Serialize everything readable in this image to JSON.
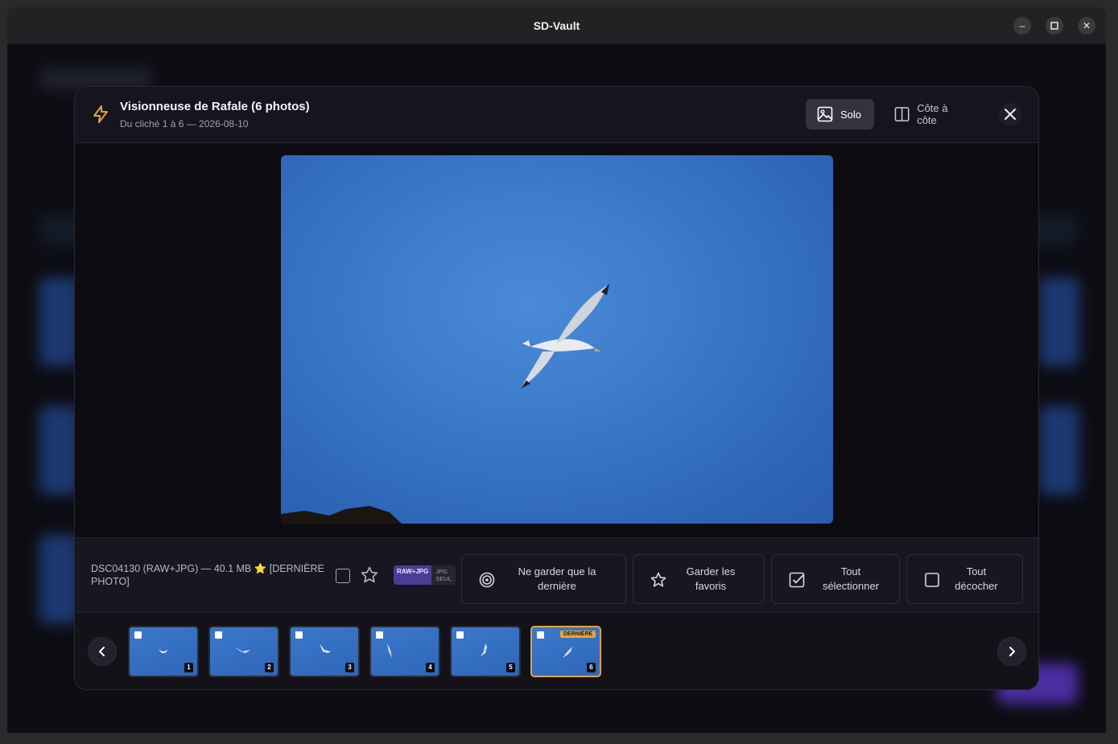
{
  "window": {
    "title": "SD-Vault"
  },
  "window_controls": {
    "minimize": "–",
    "maximize": "☐",
    "close": "✕"
  },
  "modal": {
    "title": "Visionneuse de Rafale (6 photos)",
    "subtitle": "Du cliché 1 à 6 — 2026-08-10",
    "view_solo": "Solo",
    "view_side": "Côte à côte"
  },
  "info": {
    "file_text": "DSC04130 (RAW+JPG) — 40.1 MB ⭐ [DERNIÈRE PHOTO]",
    "badge_main": "RAW+JPG",
    "badge_sub_1": "JPG",
    "badge_sub_2": "SEUL"
  },
  "actions": {
    "keep_last_1": "Ne garder que la",
    "keep_last_2": "dernière",
    "keep_fav_1": "Garder les",
    "keep_fav_2": "favoris",
    "select_all_1": "Tout",
    "select_all_2": "sélectionner",
    "uncheck_all_1": "Tout",
    "uncheck_all_2": "décocher"
  },
  "thumbnails": [
    {
      "num": "1"
    },
    {
      "num": "2"
    },
    {
      "num": "3"
    },
    {
      "num": "4"
    },
    {
      "num": "5"
    },
    {
      "num": "6",
      "last_label": "DERNIÈRE"
    }
  ],
  "colors": {
    "accent": "#e5a43a",
    "sky": "#3d7bcc",
    "badge": "#4a3d96"
  }
}
